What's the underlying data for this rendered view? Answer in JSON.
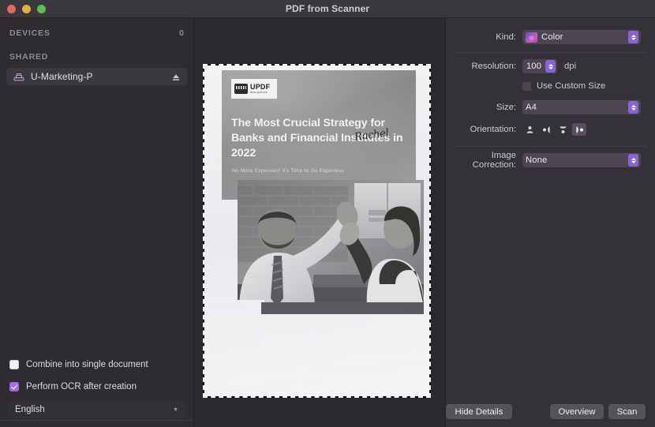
{
  "window": {
    "title": "PDF from Scanner",
    "traffic_lights": [
      "close-red",
      "minimize-yellow",
      "zoom-green"
    ],
    "colors": {
      "red": "#e06c60",
      "yellow": "#e0b040",
      "green": "#5cbd4e",
      "accent": "#8a63d6"
    }
  },
  "sidebar": {
    "devices_header": "DEVICES",
    "devices_count": "0",
    "shared_header": "SHARED",
    "shared_items": [
      {
        "name": "U-Marketing-P",
        "icon": "scanner-icon",
        "action_icon": "eject-icon",
        "selected": true
      }
    ],
    "options": [
      {
        "label": "Combine into single document",
        "checked": false
      },
      {
        "label": "Perform OCR after creation",
        "checked": true
      }
    ],
    "language": {
      "value": "English",
      "caret_icon": "chevron-down-icon"
    }
  },
  "preview": {
    "document": {
      "logo_text": "UPDF",
      "logo_sub": "www.updf.com",
      "title": "The Most Crucial Strategy for Banks and Financial Institutes in 2022",
      "subtitle": "No More Expenses! It's Time to Go Paperless",
      "signature": "Rachel",
      "photo_alt": "two-people-high-five-photo"
    }
  },
  "inspector": {
    "kind": {
      "label": "Kind:",
      "value": "Color",
      "swatch_icon": "color-swatch-icon",
      "stepper_icon": "stepper-updown-icon"
    },
    "resolution": {
      "label": "Resolution:",
      "value": "100",
      "unit": "dpi",
      "stepper_icon": "stepper-updown-icon"
    },
    "use_custom_size": {
      "label": "Use Custom Size",
      "checked": false
    },
    "size": {
      "label": "Size:",
      "value": "A4",
      "stepper_icon": "stepper-updown-icon"
    },
    "orientation": {
      "label": "Orientation:",
      "options": [
        {
          "name": "orientation-portrait-up",
          "selected": false
        },
        {
          "name": "orientation-landscape-right",
          "selected": false
        },
        {
          "name": "orientation-portrait-down",
          "selected": false
        },
        {
          "name": "orientation-landscape-left",
          "selected": true
        }
      ]
    },
    "image_correction": {
      "label": "Image Correction:",
      "value": "None",
      "stepper_icon": "stepper-updown-icon"
    }
  },
  "buttons": {
    "hide_details": "Hide Details",
    "overview": "Overview",
    "scan": "Scan"
  }
}
